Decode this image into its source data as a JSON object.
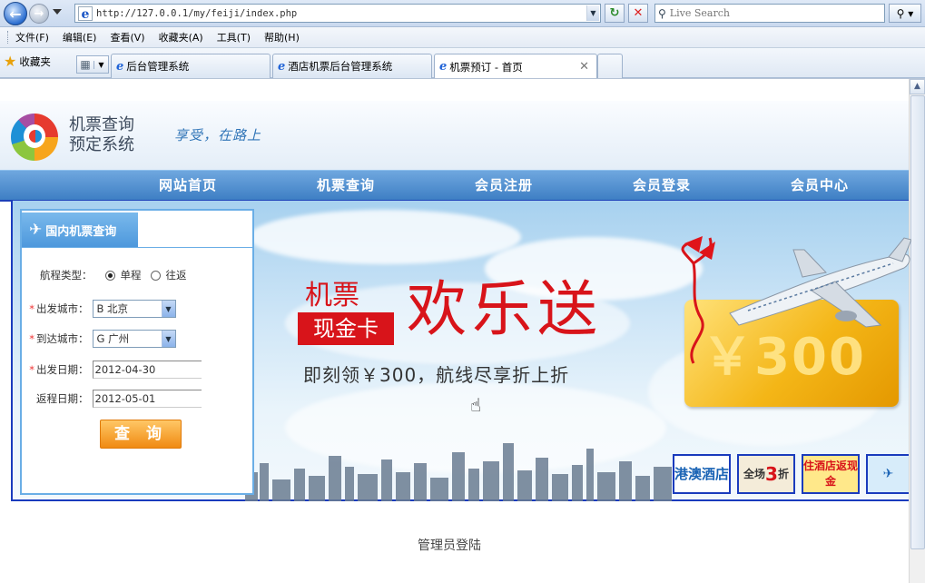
{
  "browser": {
    "url": "http://127.0.0.1/my/feiji/index.php",
    "search_placeholder": "Live Search",
    "menu": [
      "文件(F)",
      "编辑(E)",
      "查看(V)",
      "收藏夹(A)",
      "工具(T)",
      "帮助(H)"
    ],
    "favorites_label": "收藏夹",
    "tabs": [
      {
        "label": "后台管理系统"
      },
      {
        "label": "酒店机票后台管理系统"
      },
      {
        "label": "机票预订 - 首页"
      }
    ]
  },
  "site": {
    "logo_line1": "机票查询",
    "logo_line2": "预定系统",
    "slogan": "享受，在路上",
    "nav": [
      "网站首页",
      "机票查询",
      "会员注册",
      "会员登录",
      "会员中心"
    ],
    "search_panel": {
      "tab_label": "国内机票查询",
      "trip_type_label": "航程类型：",
      "trip_one_way": "单程",
      "trip_round": "往返",
      "from_label": "出发城市：",
      "from_value": "B 北京",
      "to_label": "到达城市：",
      "to_value": "G 广州",
      "depart_label": "出发日期：",
      "depart_value": "2012-04-30",
      "return_label": "返程日期：",
      "return_value": "2012-05-01",
      "submit_label": "查 询"
    },
    "promo": {
      "line1": "机票",
      "tag": "现金卡",
      "big": "欢乐送",
      "sub": "即刻领￥300，航线尽享折上折",
      "card_value": "￥300"
    },
    "mini_ads": {
      "ad1": "港澳酒店",
      "ad2_prefix": "全场",
      "ad2_num": "3",
      "ad2_suffix": "折",
      "ad3": "住酒店返现金"
    },
    "admin_login": "管理员登陆"
  }
}
